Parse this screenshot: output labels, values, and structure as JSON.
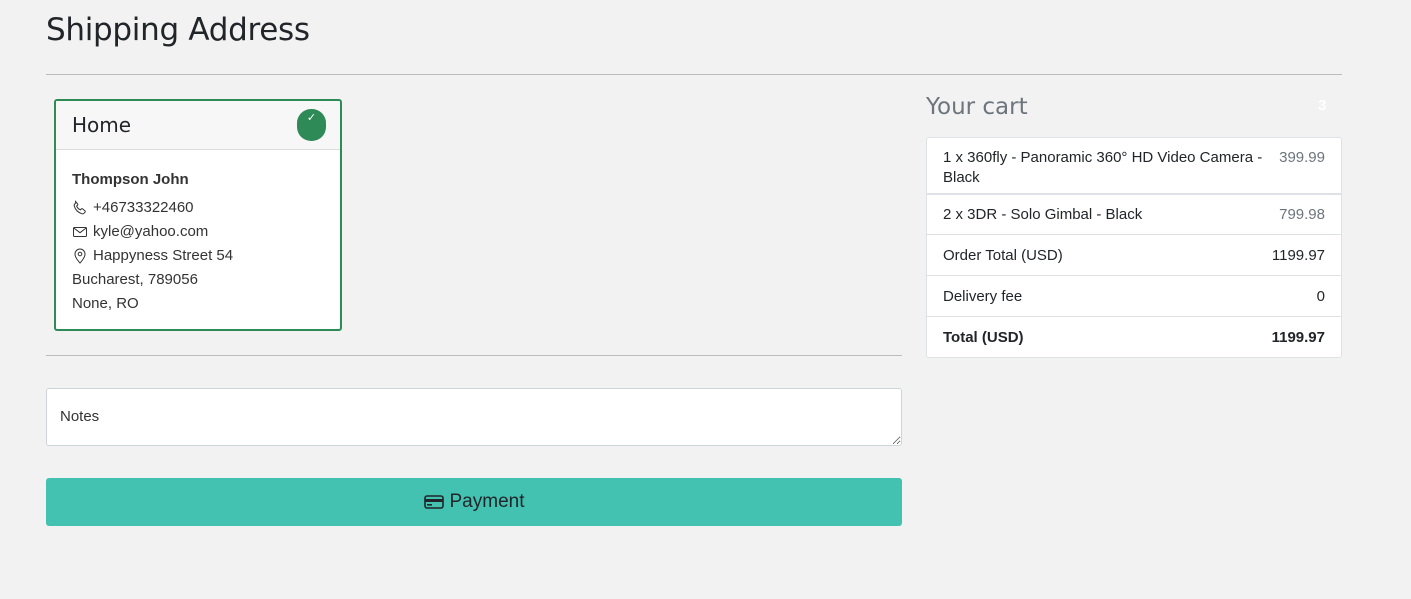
{
  "page": {
    "title": "Shipping Address"
  },
  "address_card": {
    "label": "Home",
    "name": "Thompson John",
    "phone": "+46733322460",
    "email": "kyle@yahoo.com",
    "street": "Happyness Street 54",
    "city_line": "Bucharest, 789056",
    "region_line": "None, RO",
    "selected": true,
    "accent_color": "#2e8b57"
  },
  "notes": {
    "placeholder": "Notes"
  },
  "payment_button": {
    "label": "Payment",
    "color": "#43c2b2"
  },
  "cart": {
    "title": "Your cart",
    "count": "3",
    "items": [
      {
        "name": "1 x 360fly - Panoramic 360° HD Video Camera - Black",
        "price": "399.99"
      },
      {
        "name": "2 x 3DR - Solo Gimbal - Black",
        "price": "799.98"
      }
    ],
    "order_total_label": "Order Total (USD)",
    "order_total_value": "1199.97",
    "delivery_label": "Delivery fee",
    "delivery_value": "0",
    "total_label": "Total (USD)",
    "total_value": "1199.97"
  }
}
